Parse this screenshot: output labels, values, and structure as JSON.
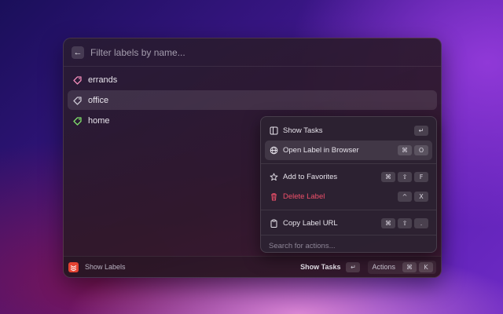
{
  "search": {
    "placeholder": "Filter labels by name..."
  },
  "labels": [
    {
      "name": "errands",
      "color": "#f08ab8",
      "selected": false
    },
    {
      "name": "office",
      "color": "#c8c3cf",
      "selected": true
    },
    {
      "name": "home",
      "color": "#7fe06a",
      "selected": false
    }
  ],
  "actions_popup": {
    "groups": [
      [
        {
          "label": "Show Tasks",
          "icon": "sidebar-icon",
          "keys": [
            "↵"
          ],
          "selected": false
        },
        {
          "label": "Open Label in Browser",
          "icon": "globe-icon",
          "keys": [
            "⌘",
            "O"
          ],
          "selected": true
        }
      ],
      [
        {
          "label": "Add to Favorites",
          "icon": "star-icon",
          "keys": [
            "⌘",
            "⇧",
            "F"
          ],
          "selected": false
        },
        {
          "label": "Delete Label",
          "icon": "trash-icon",
          "keys": [
            "^",
            "X"
          ],
          "selected": false,
          "danger": true
        }
      ],
      [
        {
          "label": "Copy Label URL",
          "icon": "clipboard-icon",
          "keys": [
            "⌘",
            "⇧",
            "."
          ],
          "selected": false
        }
      ]
    ],
    "search_placeholder": "Search for actions..."
  },
  "footer": {
    "title": "Show Labels",
    "primary_action": "Show Tasks",
    "primary_key": "↵",
    "actions_label": "Actions",
    "actions_keys": [
      "⌘",
      "K"
    ]
  },
  "colors": {
    "danger": "#f0506a",
    "app_icon": "#e44332"
  }
}
